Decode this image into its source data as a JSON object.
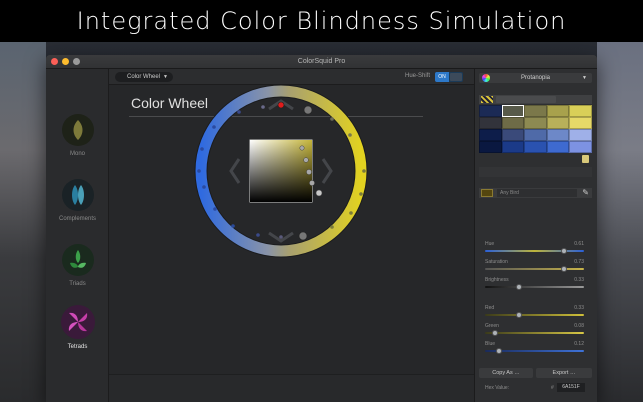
{
  "banner": {
    "text": "Integrated Color Blindness Simulation"
  },
  "window": {
    "title": "ColorSquid Pro"
  },
  "sidebar": {
    "items": [
      {
        "label": "Mono",
        "icon": "mono-leaf-icon",
        "active": false
      },
      {
        "label": "Complements",
        "icon": "complements-leaf-icon",
        "active": false
      },
      {
        "label": "Triads",
        "icon": "triads-leaf-icon",
        "active": false
      },
      {
        "label": "Tetrads",
        "icon": "tetrads-leaf-icon",
        "active": true
      }
    ]
  },
  "toolbar": {
    "mode_select": "Color Wheel",
    "hue_shift_label": "Hue-Shift",
    "hue_shift_state": "ON"
  },
  "main": {
    "title": "Color Wheel"
  },
  "panel": {
    "cb_mode": "Protanopia",
    "swatches": [
      [
        "#1b2a55",
        "#585a4a",
        "#7b784a",
        "#a8a14c",
        "#d9cf58"
      ],
      [
        "#32333b",
        "#6e6b47",
        "#8d8a52",
        "#b8b05a",
        "#e6d968"
      ],
      [
        "#0d1d4a",
        "#3a4a7a",
        "#4f6aa8",
        "#6d88c8",
        "#9fb0e8"
      ],
      [
        "#0a1840",
        "#1b3a88",
        "#2a52b0",
        "#3e6ad0",
        "#7d92e2"
      ]
    ],
    "named_placeholder": "Any Bird",
    "sliders": [
      {
        "label": "Hue",
        "value": "0.61",
        "fraction": 0.82,
        "track": "linear-gradient(90deg,#2a5fd8,#bdb43a,#2a5fd8)"
      },
      {
        "label": "Saturation",
        "value": "0.73",
        "fraction": 0.82,
        "track": "linear-gradient(90deg,#555,#c9b54a)"
      },
      {
        "label": "Brightness",
        "value": "0.33",
        "fraction": 0.33,
        "track": "linear-gradient(90deg,#111,#9a9a9a)"
      },
      {
        "label": "Red",
        "value": "0.33",
        "fraction": 0.33,
        "track": "linear-gradient(90deg,#3a3a1a,#cfc03a)"
      },
      {
        "label": "Green",
        "value": "0.08",
        "fraction": 0.08,
        "track": "linear-gradient(90deg,#3a3a1a,#d8c846)"
      },
      {
        "label": "Blue",
        "value": "0.12",
        "fraction": 0.12,
        "track": "linear-gradient(90deg,#1a2a5a,#3e72d8)"
      }
    ],
    "hex_label": "Hex Value:",
    "hex_hash": "#",
    "hex_value": "6A151F",
    "copy_label": "Copy As",
    "export_label": "Export"
  },
  "colors": {
    "wheel_blue": "#2f6ae0",
    "wheel_yellow": "#e2d220",
    "selected_marker": "#e01c1c"
  }
}
